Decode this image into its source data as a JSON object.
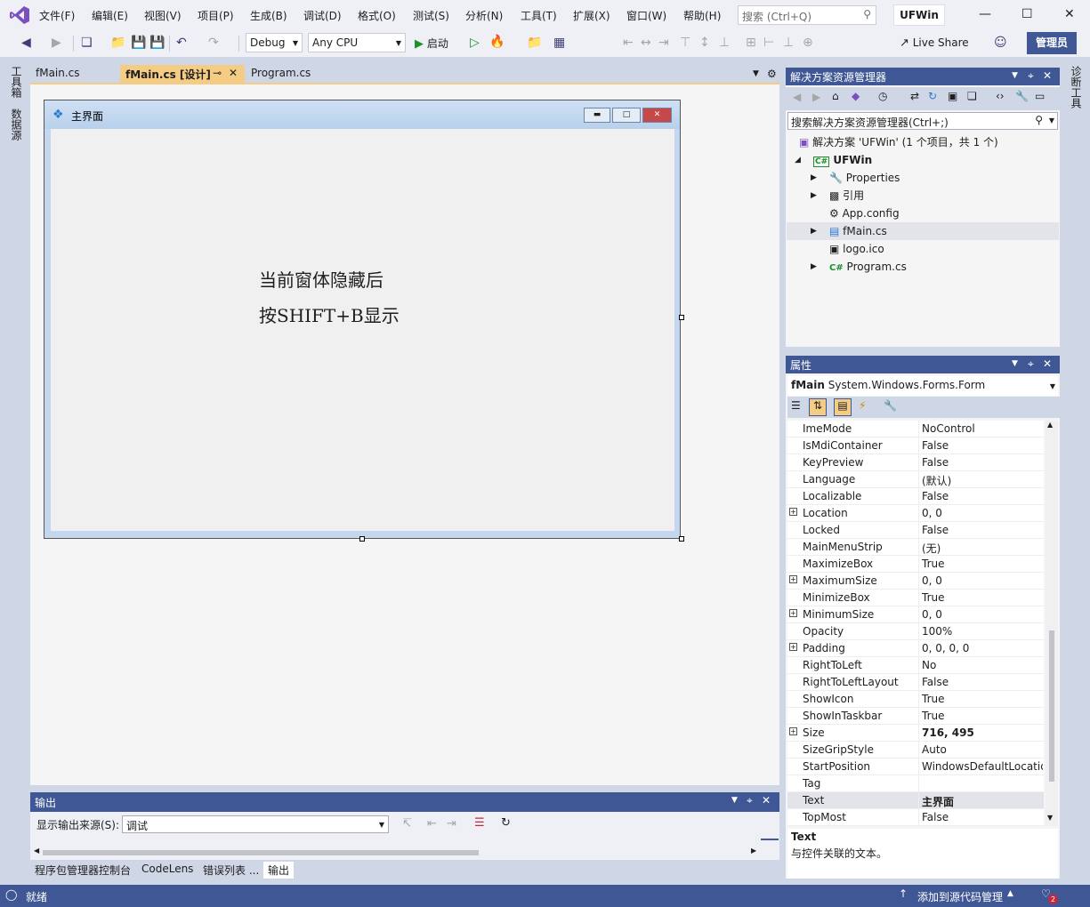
{
  "menu": {
    "items": [
      "文件(F)",
      "编辑(E)",
      "视图(V)",
      "项目(P)",
      "生成(B)",
      "调试(D)",
      "格式(O)",
      "测试(S)",
      "分析(N)",
      "工具(T)",
      "扩展(X)",
      "窗口(W)",
      "帮助(H)"
    ],
    "search_placeholder": "搜索 (Ctrl+Q)",
    "solution_name": "UFWin"
  },
  "toolbar": {
    "config": "Debug",
    "platform": "Any CPU",
    "start_label": "启动",
    "live_share": "Live Share",
    "admin": "管理员"
  },
  "side_tabs": {
    "left": [
      "工具箱",
      "数据源"
    ],
    "right": [
      "诊断工具"
    ]
  },
  "doc_tabs": {
    "fmain": "fMain.cs",
    "design": "fMain.cs [设计]",
    "pin": "⊸",
    "close": "✕",
    "program": "Program.cs"
  },
  "form": {
    "title": "主界面",
    "line1": "当前窗体隐藏后",
    "line2": "按SHIFT+B显示"
  },
  "output": {
    "title": "输出",
    "source_label": "显示输出来源(S):",
    "source_value": "调试",
    "bottom_tabs": [
      "程序包管理器控制台",
      "CodeLens",
      "错误列表 ...",
      "输出"
    ]
  },
  "solution_explorer": {
    "title": "解决方案资源管理器",
    "search_placeholder": "搜索解决方案资源管理器(Ctrl+;)",
    "tree": [
      {
        "label": "解决方案 'UFWin' (1 个项目，共 1 个)",
        "icon": "solution-icon"
      },
      {
        "label": "UFWin",
        "icon": "csharp-project-icon"
      },
      {
        "label": "Properties",
        "icon": "wrench-icon"
      },
      {
        "label": "引用",
        "icon": "references-icon"
      },
      {
        "label": "App.config",
        "icon": "config-icon"
      },
      {
        "label": "fMain.cs",
        "icon": "form-icon"
      },
      {
        "label": "logo.ico",
        "icon": "icon-file-icon"
      },
      {
        "label": "Program.cs",
        "icon": "csharp-file-icon"
      }
    ]
  },
  "properties": {
    "title": "属性",
    "object_name": "fMain",
    "object_type": "System.Windows.Forms.Form",
    "rows": [
      {
        "name": "ImeMode",
        "value": "NoControl"
      },
      {
        "name": "IsMdiContainer",
        "value": "False"
      },
      {
        "name": "KeyPreview",
        "value": "False"
      },
      {
        "name": "Language",
        "value": "(默认)"
      },
      {
        "name": "Localizable",
        "value": "False"
      },
      {
        "name": "Location",
        "value": "0, 0"
      },
      {
        "name": "Locked",
        "value": "False"
      },
      {
        "name": "MainMenuStrip",
        "value": "(无)"
      },
      {
        "name": "MaximizeBox",
        "value": "True"
      },
      {
        "name": "MaximumSize",
        "value": "0, 0"
      },
      {
        "name": "MinimizeBox",
        "value": "True"
      },
      {
        "name": "MinimumSize",
        "value": "0, 0"
      },
      {
        "name": "Opacity",
        "value": "100%"
      },
      {
        "name": "Padding",
        "value": "0, 0, 0, 0"
      },
      {
        "name": "RightToLeft",
        "value": "No"
      },
      {
        "name": "RightToLeftLayout",
        "value": "False"
      },
      {
        "name": "ShowIcon",
        "value": "True"
      },
      {
        "name": "ShowInTaskbar",
        "value": "True"
      },
      {
        "name": "Size",
        "value": "716, 495"
      },
      {
        "name": "SizeGripStyle",
        "value": "Auto"
      },
      {
        "name": "StartPosition",
        "value": "WindowsDefaultLocation"
      },
      {
        "name": "Tag",
        "value": ""
      },
      {
        "name": "Text",
        "value": "主界面"
      },
      {
        "name": "TopMost",
        "value": "False"
      }
    ],
    "desc_title": "Text",
    "desc_text": "与控件关联的文本。"
  },
  "status": {
    "ready": "就绪",
    "source_control": "添加到源代码管理",
    "notifications": "2"
  }
}
